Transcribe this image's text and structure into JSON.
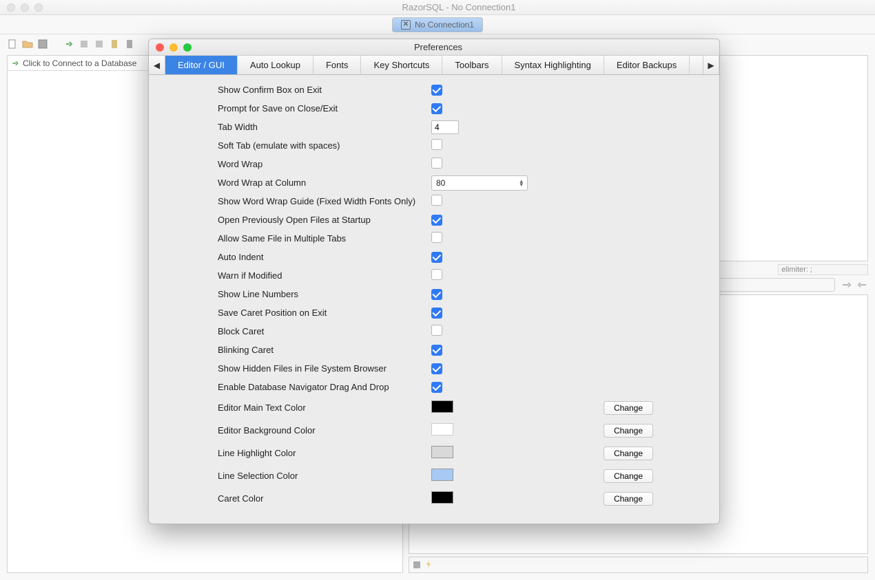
{
  "app": {
    "title": "RazorSQL - No Connection1",
    "connection_tab": "No Connection1",
    "connect_prompt": "Click to Connect to a Database"
  },
  "editor_info": {
    "elimiter": "elimiter: ;"
  },
  "prefs": {
    "title": "Preferences",
    "tabs": [
      "Editor / GUI",
      "Auto Lookup",
      "Fonts",
      "Key Shortcuts",
      "Toolbars",
      "Syntax Highlighting",
      "Editor Backups"
    ],
    "active_tab_index": 0,
    "change_label": "Change",
    "rows": [
      {
        "label": "Show Confirm Box on Exit",
        "type": "check",
        "checked": true
      },
      {
        "label": "Prompt for Save on Close/Exit",
        "type": "check",
        "checked": true
      },
      {
        "label": "Tab Width",
        "type": "input",
        "value": "4"
      },
      {
        "label": "Soft Tab (emulate with spaces)",
        "type": "check",
        "checked": false
      },
      {
        "label": "Word Wrap",
        "type": "check",
        "checked": false
      },
      {
        "label": "Word Wrap at Column",
        "type": "combo",
        "value": "80"
      },
      {
        "label": "Show Word Wrap Guide (Fixed Width Fonts Only)",
        "type": "check",
        "checked": false
      },
      {
        "label": "Open Previously Open Files at Startup",
        "type": "check",
        "checked": true
      },
      {
        "label": "Allow Same File in Multiple Tabs",
        "type": "check",
        "checked": false
      },
      {
        "label": "Auto Indent",
        "type": "check",
        "checked": true
      },
      {
        "label": "Warn if Modified",
        "type": "check",
        "checked": false
      },
      {
        "label": "Show Line Numbers",
        "type": "check",
        "checked": true
      },
      {
        "label": "Save Caret Position on Exit",
        "type": "check",
        "checked": true
      },
      {
        "label": "Block Caret",
        "type": "check",
        "checked": false
      },
      {
        "label": "Blinking Caret",
        "type": "check",
        "checked": true
      },
      {
        "label": "Show Hidden Files in File System Browser",
        "type": "check",
        "checked": true
      },
      {
        "label": "Enable Database Navigator Drag And Drop",
        "type": "check",
        "checked": true
      },
      {
        "label": "Editor Main Text Color",
        "type": "color",
        "value": "#000000"
      },
      {
        "label": "Editor Background Color",
        "type": "color",
        "value": "#ffffff"
      },
      {
        "label": "Line Highlight Color",
        "type": "color",
        "value": "#d9d9d9"
      },
      {
        "label": "Line Selection Color",
        "type": "color",
        "value": "#a7c9f3"
      },
      {
        "label": "Caret Color",
        "type": "color",
        "value": "#000000"
      }
    ]
  }
}
